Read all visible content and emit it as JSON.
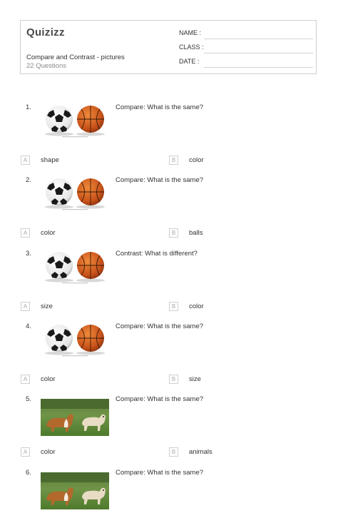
{
  "header": {
    "logo": "Quizizz",
    "title": "Compare and Contrast - pictures",
    "subtitle": "22 Questions",
    "name_label": "NAME :",
    "class_label": "CLASS :",
    "date_label": "DATE  :"
  },
  "questions": [
    {
      "number": "1.",
      "text": "Compare: What is the same?",
      "image": "balls-icon",
      "options": [
        {
          "letter": "A",
          "text": "shape"
        },
        {
          "letter": "B",
          "text": "color"
        }
      ]
    },
    {
      "number": "2.",
      "text": "Compare: What is the same?",
      "image": "balls-icon",
      "options": [
        {
          "letter": "A",
          "text": "color"
        },
        {
          "letter": "B",
          "text": "balls"
        }
      ]
    },
    {
      "number": "3.",
      "text": "Contrast: What is different?",
      "image": "balls-icon",
      "options": [
        {
          "letter": "A",
          "text": "size"
        },
        {
          "letter": "B",
          "text": "color"
        }
      ]
    },
    {
      "number": "4.",
      "text": "Compare: What is the same?",
      "image": "balls-icon",
      "options": [
        {
          "letter": "A",
          "text": "color"
        },
        {
          "letter": "B",
          "text": "size"
        }
      ]
    },
    {
      "number": "5.",
      "text": "Compare: What is the same?",
      "image": "dogs-icon",
      "options": [
        {
          "letter": "A",
          "text": "color"
        },
        {
          "letter": "B",
          "text": "animals"
        }
      ]
    },
    {
      "number": "6.",
      "text": "Compare: What is the same?",
      "image": "dogs-icon",
      "options": []
    }
  ]
}
